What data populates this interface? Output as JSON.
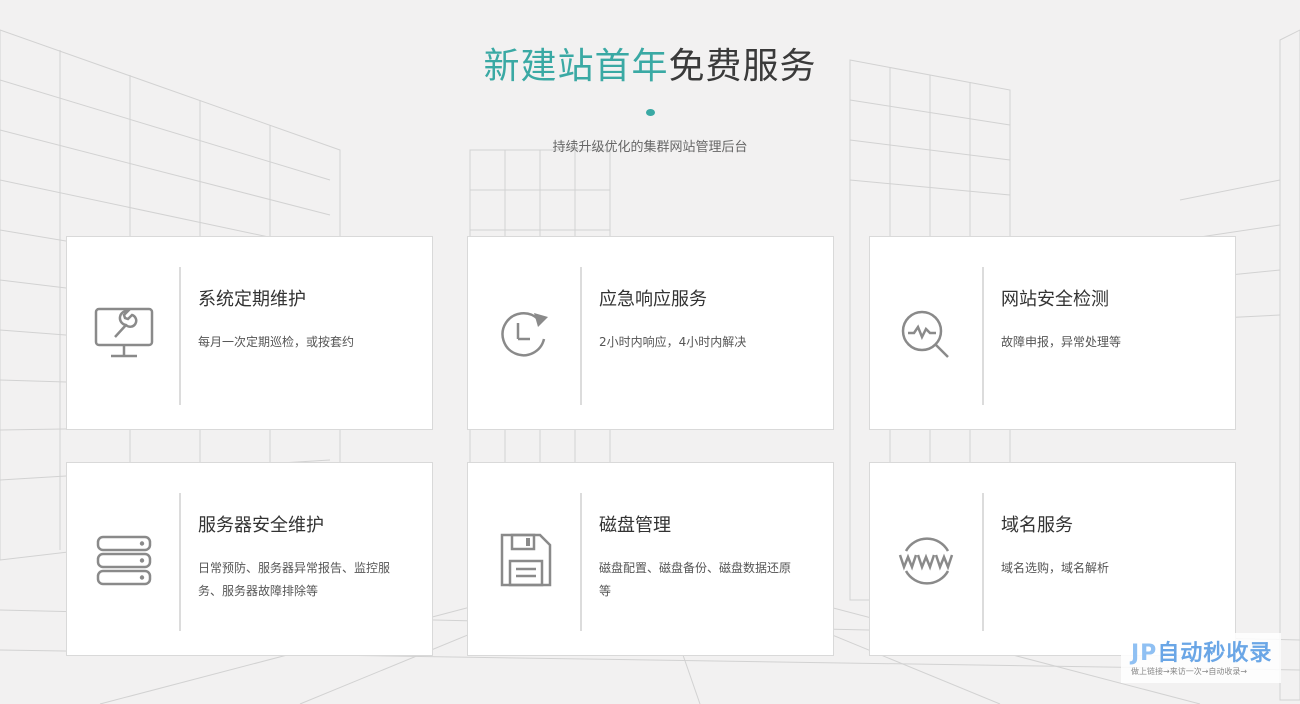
{
  "header": {
    "title_accent": "新建站首年",
    "title_rest": "免费服务",
    "subtitle": "持续升级优化的集群网站管理后台"
  },
  "colors": {
    "accent": "#3aa9a4",
    "icon": "#8a8a8a"
  },
  "cards": [
    {
      "title": "系统定期维护",
      "desc": "每月一次定期巡检，或按套约",
      "icon": "monitor-wrench-icon"
    },
    {
      "title": "应急响应服务",
      "desc": "2小时内响应，4小时内解决",
      "icon": "clock-refresh-icon"
    },
    {
      "title": "网站安全检测",
      "desc": "故障申报，异常处理等",
      "icon": "magnifier-pulse-icon"
    },
    {
      "title": "服务器安全维护",
      "desc": "日常预防、服务器异常报告、监控服务、服务器故障排除等",
      "icon": "server-stack-icon"
    },
    {
      "title": "磁盘管理",
      "desc": "磁盘配置、磁盘备份、磁盘数据还原等",
      "icon": "floppy-disk-icon"
    },
    {
      "title": "域名服务",
      "desc": "域名选购，域名解析",
      "icon": "www-globe-icon"
    }
  ],
  "watermark": {
    "logo_prefix": "JP",
    "logo_text": "自动秒收录",
    "sub": "做上链接→来访一次→自动收录→"
  }
}
